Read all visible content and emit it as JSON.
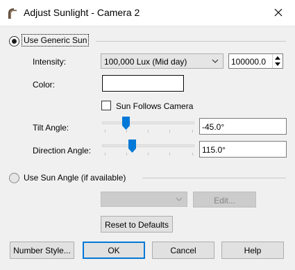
{
  "window": {
    "title": "Adjust Sunlight - Camera 2"
  },
  "generic_sun": {
    "radio_label": "Use Generic Sun",
    "selected": true,
    "intensity_label": "Intensity:",
    "intensity_option": "100,000 Lux (Mid day)",
    "intensity_value": "100000.0",
    "color_label": "Color:",
    "color_value": "#ffffff",
    "follows_camera_label": "Sun Follows Camera",
    "follows_camera_checked": false,
    "tilt_label": "Tilt Angle:",
    "tilt_value": "-45.0°",
    "direction_label": "Direction Angle:",
    "direction_value": "115.0°"
  },
  "sun_angle": {
    "radio_label": "Use Sun Angle (if available)",
    "selected": false,
    "select_value": "",
    "edit_label": "Edit..."
  },
  "reset_label": "Reset to Defaults",
  "footer": {
    "number_style": "Number Style...",
    "ok": "OK",
    "cancel": "Cancel",
    "help": "Help"
  },
  "icons": {
    "app": "arch-icon",
    "close": "close-icon",
    "dropdown": "chevron-down-icon",
    "spin": "spinner-arrows-icon"
  },
  "colors": {
    "accent": "#0078d7",
    "background": "#f0f0f0"
  }
}
